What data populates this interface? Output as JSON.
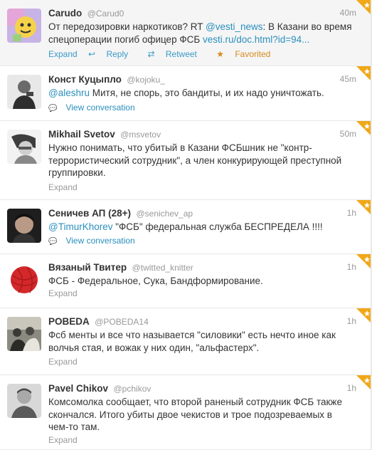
{
  "tweets": [
    {
      "name": "Carudo",
      "handle": "@Carud0",
      "time": "40m",
      "text_parts": [
        {
          "t": "От передозировки наркотиков? RT ",
          "link": false
        },
        {
          "t": "@vesti_news",
          "link": true
        },
        {
          "t": ": В Казани во время спецоперации погиб офицер ФСБ ",
          "link": false
        },
        {
          "t": "vesti.ru/doc.html?id=94...",
          "link": true
        }
      ],
      "actions": {
        "expand": "Expand",
        "reply": "Reply",
        "retweet": "Retweet",
        "favorited": "Favorited"
      },
      "avatar": "cartoon-avatar",
      "highlighted": true
    },
    {
      "name": "Конст Куцыпло",
      "handle": "@kojoku_",
      "time": "45m",
      "text_parts": [
        {
          "t": "@aleshru",
          "link": true
        },
        {
          "t": " Митя, не спорь, это бандиты, и их надо уничтожать.",
          "link": false
        }
      ],
      "view_conversation": "View conversation",
      "avatar": "person-avatar"
    },
    {
      "name": "Mikhail Svetov",
      "handle": "@msvetov",
      "time": "50m",
      "text_parts": [
        {
          "t": "Нужно понимать, что убитый в Казани ФСБшник не \"контр-террористический сотрудник\", а член конкурирующей преступной группировки.",
          "link": false
        }
      ],
      "expand": "Expand",
      "avatar": "person-avatar"
    },
    {
      "name": "Сеничев АП (28+)",
      "handle": "@senichev_ap",
      "time": "1h",
      "text_parts": [
        {
          "t": "@TimurKhorev",
          "link": true
        },
        {
          "t": " \"ФСБ\" федеральная служба БЕСПРЕДЕЛА !!!!",
          "link": false
        }
      ],
      "view_conversation": "View conversation",
      "avatar": "person-avatar"
    },
    {
      "name": "Вязаный Твитер",
      "handle": "@twitted_knitter",
      "time": "1h",
      "text_parts": [
        {
          "t": "ФСБ - Федеральное, Сука, Бандформирование.",
          "link": false
        }
      ],
      "expand": "Expand",
      "avatar": "yarn-ball-avatar"
    },
    {
      "name": "POBEDA",
      "handle": "@POBEDA14",
      "time": "1h",
      "text_parts": [
        {
          "t": "Фсб менты и все что называется \"силовики\" есть нечто иное как волчья стая, и вожак у них один, \"альфастерх\".",
          "link": false
        }
      ],
      "expand": "Expand",
      "avatar": "photo-avatar"
    },
    {
      "name": "Pavel Chikov",
      "handle": "@pchikov",
      "time": "1h",
      "text_parts": [
        {
          "t": "Комсомолка сообщает, что второй раненый сотрудник ФСБ также скончался. Итого убиты двое чекистов и трое подозреваемых в чем-то там.",
          "link": false
        }
      ],
      "expand": "Expand",
      "avatar": "person-avatar"
    }
  ],
  "colors": {
    "link": "#2a8fbd",
    "favorite": "#d58a1e",
    "corner": "#f0a818"
  }
}
